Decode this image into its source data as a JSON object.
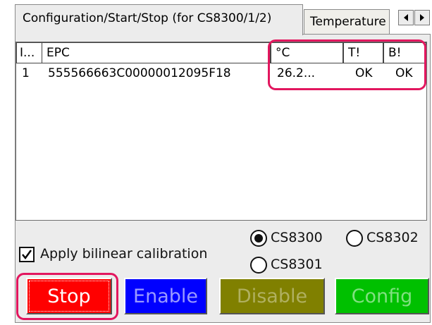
{
  "tabs": {
    "active_label": "Configuration/Start/Stop (for CS8300/1/2)",
    "next_label": "Temperature"
  },
  "table": {
    "columns": [
      "I...",
      "EPC",
      "°C",
      "T!",
      "B!"
    ],
    "rows": [
      {
        "index": "1",
        "epc": "555566663C00000012095F18",
        "temp": "26.2...",
        "t_flag": "OK",
        "b_flag": "OK"
      }
    ]
  },
  "options": {
    "calibration_label": "Apply bilinear calibration",
    "calibration_checked": true,
    "models": [
      "CS8300",
      "CS8302",
      "CS8301"
    ],
    "selected_model": "CS8300"
  },
  "buttons": {
    "stop": "Stop",
    "enable": "Enable",
    "disable": "Disable",
    "config": "Config"
  },
  "colors": {
    "highlight": "#e2165e",
    "stop_bg": "#ff0000",
    "enable_bg": "#0000ff",
    "disable_bg": "#808000",
    "config_bg": "#00c000"
  },
  "icons": [
    "scroll-left-icon",
    "scroll-right-icon",
    "checkmark-icon",
    "radio-selected-icon"
  ]
}
